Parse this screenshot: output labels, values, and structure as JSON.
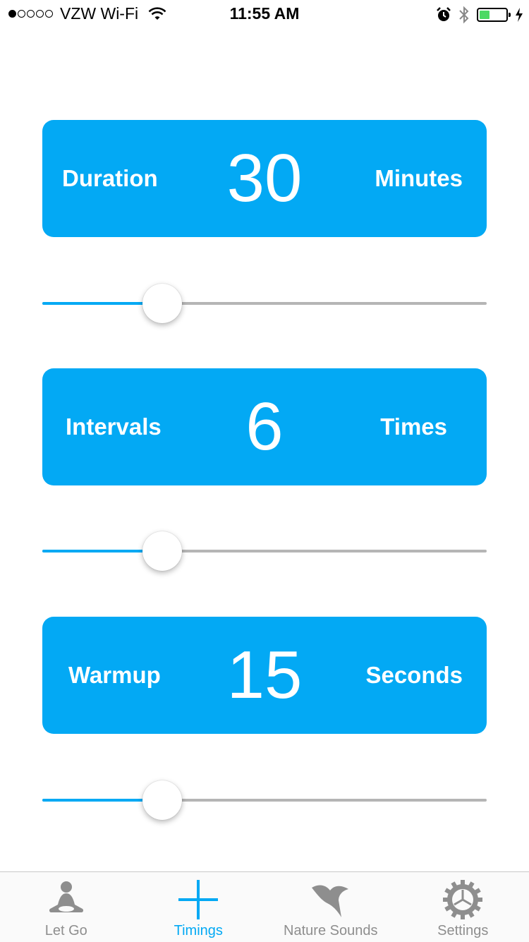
{
  "status_bar": {
    "carrier": "VZW Wi-Fi",
    "time": "11:55 AM",
    "signal_bars_filled": 1,
    "signal_bars_total": 5,
    "battery_level": 0.4
  },
  "settings": [
    {
      "label": "Duration",
      "value": "30",
      "unit": "Minutes",
      "slider_level": 0.27
    },
    {
      "label": "Intervals",
      "value": "6",
      "unit": "Times",
      "slider_level": 0.27
    },
    {
      "label": "Warmup",
      "value": "15",
      "unit": "Seconds",
      "slider_level": 0.27
    }
  ],
  "tabs": [
    {
      "label": "Let Go",
      "icon": "meditation-icon",
      "active": false
    },
    {
      "label": "Timings",
      "icon": "plus-icon",
      "active": true
    },
    {
      "label": "Nature Sounds",
      "icon": "bird-icon",
      "active": false
    },
    {
      "label": "Settings",
      "icon": "gear-icon",
      "active": false
    }
  ],
  "colors": {
    "accent": "#03a9f4",
    "inactive": "#8e8e8e",
    "track": "#b5b5b5",
    "battery": "#4cd964"
  }
}
